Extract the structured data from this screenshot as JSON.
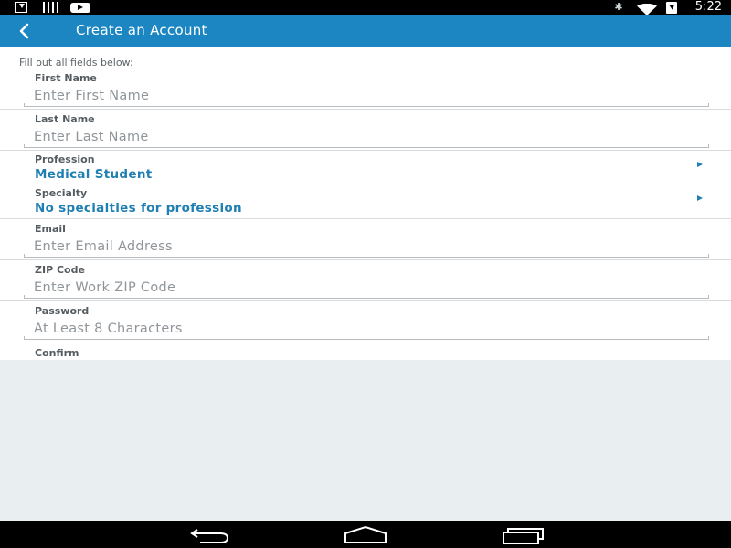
{
  "status_bar": {
    "time": "5:22",
    "icons": [
      "download-icon",
      "barcode-icon",
      "youtube-icon",
      "bluetooth-icon",
      "wifi-icon",
      "battery-charging-icon"
    ]
  },
  "action_bar": {
    "title": "Create an Account",
    "back_icon": "chevron-left-icon"
  },
  "form": {
    "instructions": "Fill out all fields below:",
    "first_name": {
      "label": "First Name",
      "placeholder": "Enter First Name",
      "value": ""
    },
    "last_name": {
      "label": "Last Name",
      "placeholder": "Enter Last Name",
      "value": ""
    },
    "profession": {
      "label": "Profession",
      "value": "Medical Student"
    },
    "specialty": {
      "label": "Specialty",
      "value": "No specialties for profession"
    },
    "email": {
      "label": "Email",
      "placeholder": "Enter Email Address",
      "value": ""
    },
    "zip": {
      "label": "ZIP Code",
      "placeholder": "Enter Work ZIP Code",
      "value": ""
    },
    "password": {
      "label": "Password",
      "placeholder": "At Least 8 Characters",
      "value": ""
    },
    "confirm": {
      "label": "Confirm"
    }
  },
  "nav_bar": {
    "buttons": [
      "back-icon",
      "home-icon",
      "recents-icon"
    ]
  },
  "colors": {
    "accent": "#1b86c1",
    "link_value": "#1f7fb3",
    "background": "#e9eef1"
  }
}
